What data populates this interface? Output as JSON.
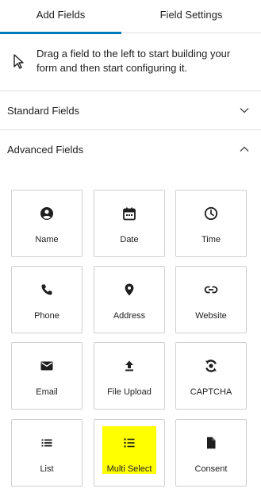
{
  "colors": {
    "accent": "#007cba",
    "highlight": "#ffff00",
    "text": "#1e1e1e",
    "border": "#e0e0e0"
  },
  "tabs": [
    {
      "label": "Add Fields",
      "active": true
    },
    {
      "label": "Field Settings",
      "active": false
    }
  ],
  "hint": {
    "icon": "cursor-arrow-icon",
    "text": "Drag a field to the left to start building your form and then start configuring it."
  },
  "sections": {
    "standard": {
      "label": "Standard Fields",
      "expanded": false,
      "icon": "chevron-down-icon"
    },
    "advanced": {
      "label": "Advanced Fields",
      "expanded": true,
      "icon": "chevron-up-icon"
    }
  },
  "fields": [
    {
      "label": "Name",
      "icon": "user-circle-icon"
    },
    {
      "label": "Date",
      "icon": "calendar-icon"
    },
    {
      "label": "Time",
      "icon": "clock-icon"
    },
    {
      "label": "Phone",
      "icon": "phone-icon"
    },
    {
      "label": "Address",
      "icon": "map-pin-icon"
    },
    {
      "label": "Website",
      "icon": "link-icon"
    },
    {
      "label": "Email",
      "icon": "envelope-icon"
    },
    {
      "label": "File Upload",
      "icon": "upload-icon"
    },
    {
      "label": "CAPTCHA",
      "icon": "recaptcha-icon"
    },
    {
      "label": "List",
      "icon": "list-icon"
    },
    {
      "label": "Multi Select",
      "icon": "multi-select-icon",
      "highlighted": true
    },
    {
      "label": "Consent",
      "icon": "document-icon"
    }
  ]
}
